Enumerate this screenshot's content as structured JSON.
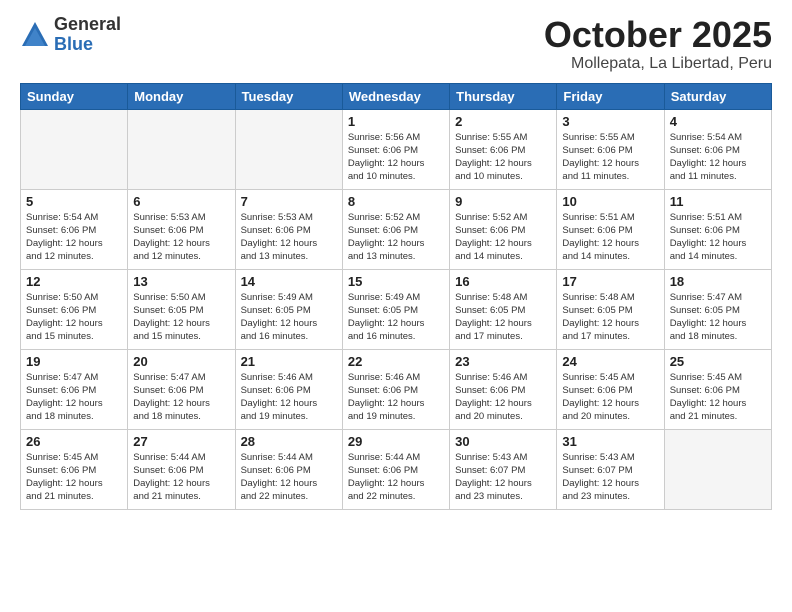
{
  "logo": {
    "general": "General",
    "blue": "Blue"
  },
  "header": {
    "month": "October 2025",
    "location": "Mollepata, La Libertad, Peru"
  },
  "weekdays": [
    "Sunday",
    "Monday",
    "Tuesday",
    "Wednesday",
    "Thursday",
    "Friday",
    "Saturday"
  ],
  "weeks": [
    [
      {
        "day": "",
        "info": ""
      },
      {
        "day": "",
        "info": ""
      },
      {
        "day": "",
        "info": ""
      },
      {
        "day": "1",
        "info": "Sunrise: 5:56 AM\nSunset: 6:06 PM\nDaylight: 12 hours\nand 10 minutes."
      },
      {
        "day": "2",
        "info": "Sunrise: 5:55 AM\nSunset: 6:06 PM\nDaylight: 12 hours\nand 10 minutes."
      },
      {
        "day": "3",
        "info": "Sunrise: 5:55 AM\nSunset: 6:06 PM\nDaylight: 12 hours\nand 11 minutes."
      },
      {
        "day": "4",
        "info": "Sunrise: 5:54 AM\nSunset: 6:06 PM\nDaylight: 12 hours\nand 11 minutes."
      }
    ],
    [
      {
        "day": "5",
        "info": "Sunrise: 5:54 AM\nSunset: 6:06 PM\nDaylight: 12 hours\nand 12 minutes."
      },
      {
        "day": "6",
        "info": "Sunrise: 5:53 AM\nSunset: 6:06 PM\nDaylight: 12 hours\nand 12 minutes."
      },
      {
        "day": "7",
        "info": "Sunrise: 5:53 AM\nSunset: 6:06 PM\nDaylight: 12 hours\nand 13 minutes."
      },
      {
        "day": "8",
        "info": "Sunrise: 5:52 AM\nSunset: 6:06 PM\nDaylight: 12 hours\nand 13 minutes."
      },
      {
        "day": "9",
        "info": "Sunrise: 5:52 AM\nSunset: 6:06 PM\nDaylight: 12 hours\nand 14 minutes."
      },
      {
        "day": "10",
        "info": "Sunrise: 5:51 AM\nSunset: 6:06 PM\nDaylight: 12 hours\nand 14 minutes."
      },
      {
        "day": "11",
        "info": "Sunrise: 5:51 AM\nSunset: 6:06 PM\nDaylight: 12 hours\nand 14 minutes."
      }
    ],
    [
      {
        "day": "12",
        "info": "Sunrise: 5:50 AM\nSunset: 6:06 PM\nDaylight: 12 hours\nand 15 minutes."
      },
      {
        "day": "13",
        "info": "Sunrise: 5:50 AM\nSunset: 6:05 PM\nDaylight: 12 hours\nand 15 minutes."
      },
      {
        "day": "14",
        "info": "Sunrise: 5:49 AM\nSunset: 6:05 PM\nDaylight: 12 hours\nand 16 minutes."
      },
      {
        "day": "15",
        "info": "Sunrise: 5:49 AM\nSunset: 6:05 PM\nDaylight: 12 hours\nand 16 minutes."
      },
      {
        "day": "16",
        "info": "Sunrise: 5:48 AM\nSunset: 6:05 PM\nDaylight: 12 hours\nand 17 minutes."
      },
      {
        "day": "17",
        "info": "Sunrise: 5:48 AM\nSunset: 6:05 PM\nDaylight: 12 hours\nand 17 minutes."
      },
      {
        "day": "18",
        "info": "Sunrise: 5:47 AM\nSunset: 6:05 PM\nDaylight: 12 hours\nand 18 minutes."
      }
    ],
    [
      {
        "day": "19",
        "info": "Sunrise: 5:47 AM\nSunset: 6:06 PM\nDaylight: 12 hours\nand 18 minutes."
      },
      {
        "day": "20",
        "info": "Sunrise: 5:47 AM\nSunset: 6:06 PM\nDaylight: 12 hours\nand 18 minutes."
      },
      {
        "day": "21",
        "info": "Sunrise: 5:46 AM\nSunset: 6:06 PM\nDaylight: 12 hours\nand 19 minutes."
      },
      {
        "day": "22",
        "info": "Sunrise: 5:46 AM\nSunset: 6:06 PM\nDaylight: 12 hours\nand 19 minutes."
      },
      {
        "day": "23",
        "info": "Sunrise: 5:46 AM\nSunset: 6:06 PM\nDaylight: 12 hours\nand 20 minutes."
      },
      {
        "day": "24",
        "info": "Sunrise: 5:45 AM\nSunset: 6:06 PM\nDaylight: 12 hours\nand 20 minutes."
      },
      {
        "day": "25",
        "info": "Sunrise: 5:45 AM\nSunset: 6:06 PM\nDaylight: 12 hours\nand 21 minutes."
      }
    ],
    [
      {
        "day": "26",
        "info": "Sunrise: 5:45 AM\nSunset: 6:06 PM\nDaylight: 12 hours\nand 21 minutes."
      },
      {
        "day": "27",
        "info": "Sunrise: 5:44 AM\nSunset: 6:06 PM\nDaylight: 12 hours\nand 21 minutes."
      },
      {
        "day": "28",
        "info": "Sunrise: 5:44 AM\nSunset: 6:06 PM\nDaylight: 12 hours\nand 22 minutes."
      },
      {
        "day": "29",
        "info": "Sunrise: 5:44 AM\nSunset: 6:06 PM\nDaylight: 12 hours\nand 22 minutes."
      },
      {
        "day": "30",
        "info": "Sunrise: 5:43 AM\nSunset: 6:07 PM\nDaylight: 12 hours\nand 23 minutes."
      },
      {
        "day": "31",
        "info": "Sunrise: 5:43 AM\nSunset: 6:07 PM\nDaylight: 12 hours\nand 23 minutes."
      },
      {
        "day": "",
        "info": ""
      }
    ]
  ]
}
